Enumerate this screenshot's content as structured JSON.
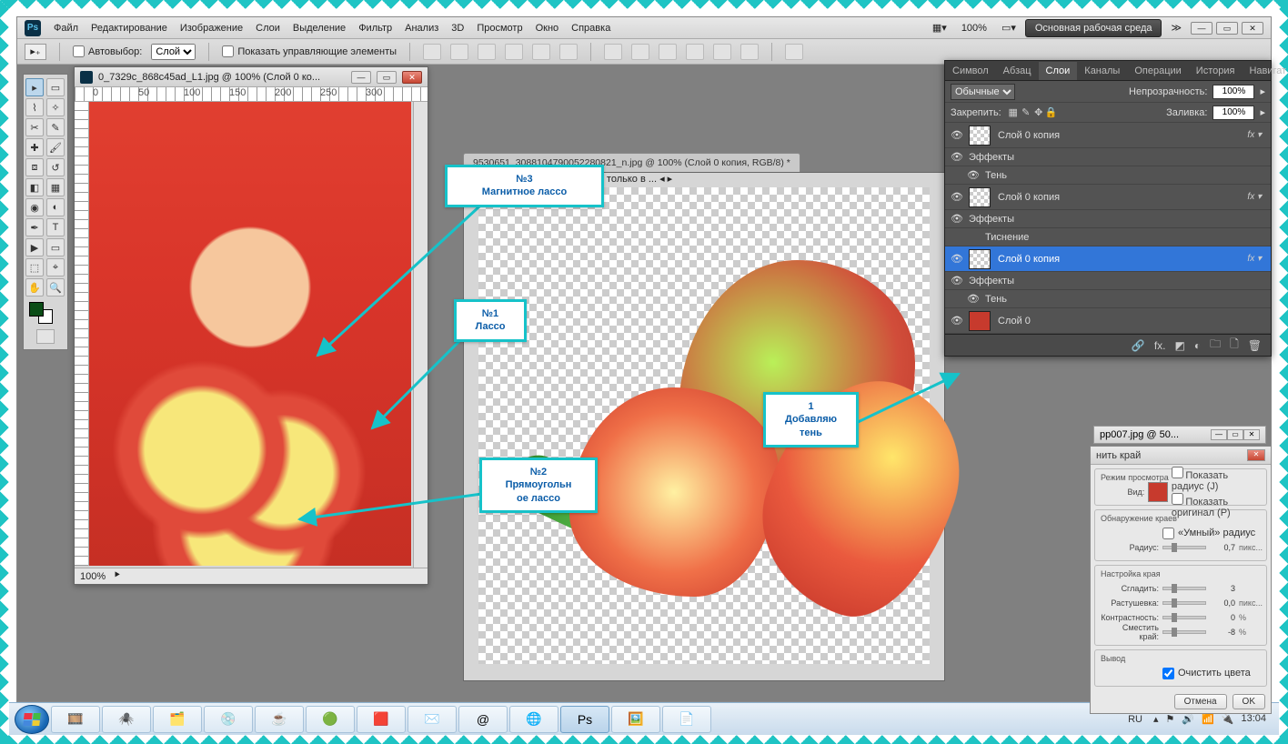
{
  "menu": {
    "items": [
      "Файл",
      "Редактирование",
      "Изображение",
      "Слои",
      "Выделение",
      "Фильтр",
      "Анализ",
      "3D",
      "Просмотр",
      "Окно",
      "Справка"
    ],
    "zoom": "100%",
    "workspace_label": "Основная рабочая среда"
  },
  "options": {
    "autoselect_label": "Автовыбор:",
    "autoselect_value": "Слой",
    "show_controls_label": "Показать управляющие элементы"
  },
  "doc1": {
    "title": "0_7329c_868c45ad_L1.jpg @ 100% (Слой 0 ко...",
    "zoom": "100%"
  },
  "doc2": {
    "tab": "9530651_308810479005228082​1_n.jpg @ 100% (Слой 0 копия, RGB/8) *",
    "zoom": "100%",
    "status": "Экспозиция работает только в ..."
  },
  "doc3": {
    "title": "pp007.jpg @ 50..."
  },
  "callouts": {
    "c1": {
      "l1": "№1",
      "l2": "Лассо"
    },
    "c2": {
      "l1": "№2",
      "l2": "Прямоугольн",
      "l3": "ое лассо"
    },
    "c3": {
      "l1": "№3",
      "l2": "Магнитное лассо"
    },
    "c4": {
      "l1": "1",
      "l2": "Добавляю",
      "l3": "тень"
    }
  },
  "layers_panel": {
    "tabs": [
      "Символ",
      "Абзац",
      "Слои",
      "Каналы",
      "Операции",
      "История",
      "Навигат"
    ],
    "blend_mode": "Обычные",
    "opacity_label": "Непрозрачность:",
    "opacity_value": "100%",
    "lock_label": "Закрепить:",
    "fill_label": "Заливка:",
    "fill_value": "100%",
    "layers": [
      {
        "name": "Слой 0 копия",
        "fx": true,
        "sub": [
          "Эффекты",
          "Тень"
        ]
      },
      {
        "name": "Слой 0 копия",
        "fx": true,
        "sub": [
          "Эффекты",
          "Тиснение"
        ]
      },
      {
        "name": "Слой 0 копия",
        "fx": true,
        "selected": true,
        "sub": [
          "Эффекты",
          "Тень"
        ]
      },
      {
        "name": "Слой 0",
        "fx": false,
        "img": true
      }
    ],
    "fx_label": "Эффекты",
    "sub_shadow": "Тень",
    "sub_emboss": "Тиснение"
  },
  "refine": {
    "title": "нить край",
    "section_view": "Режим просмотра",
    "view_label": "Вид:",
    "show_radius": "Показать радиус (J)",
    "show_original": "Показать оригинал (P)",
    "section_edge": "Обнаружение краев",
    "smart_radius": "«Умный» радиус",
    "radius_label": "Радиус:",
    "radius_value": "0,7",
    "radius_unit": "пикс...",
    "section_adjust": "Настройка края",
    "smooth_label": "Сгладить:",
    "smooth_value": "3",
    "feather_label": "Растушевка:",
    "feather_value": "0,0",
    "feather_unit": "пикс...",
    "contrast_label": "Контрастность:",
    "contrast_value": "0",
    "contrast_unit": "%",
    "shift_label": "Сместить край:",
    "shift_value": "-8",
    "shift_unit": "%",
    "section_output": "Вывод",
    "decontaminate": "Очистить цвета",
    "ok": "OK",
    "cancel": "Отмена"
  },
  "taskbar": {
    "lang": "RU",
    "time": "13:04"
  }
}
